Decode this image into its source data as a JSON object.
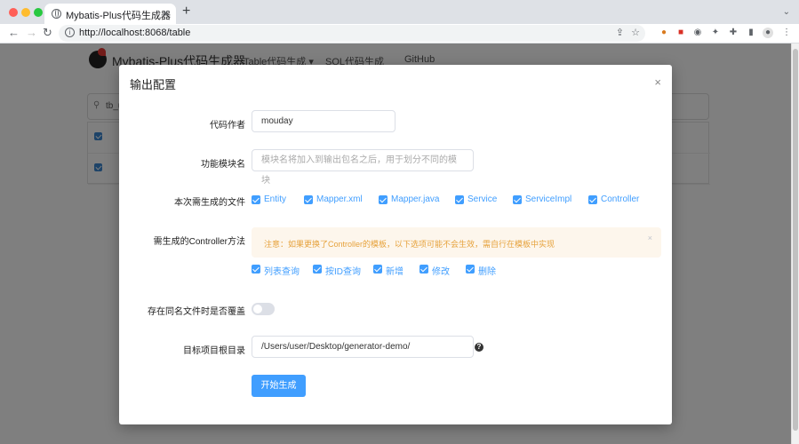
{
  "browser": {
    "tab_title": "Mybatis-Plus代码生成器",
    "tab_close": "×",
    "new_tab": "+",
    "url": "http://localhost:8068/table"
  },
  "page": {
    "brand": "Mybatis-Plus代码生成器",
    "nav": [
      "Table代码生成 ▾",
      "SQL代码生成",
      "GitHub"
    ],
    "search_text": "tb_u"
  },
  "modal": {
    "title": "输出配置",
    "close": "×",
    "author_label": "代码作者",
    "author_value": "mouday",
    "module_label": "功能模块名",
    "module_placeholder": "模块名将加入到输出包名之后，用于划分不同的模块",
    "files_label": "本次需生成的文件",
    "files": [
      "Entity",
      "Mapper.xml",
      "Mapper.java",
      "Service",
      "ServiceImpl",
      "Controller"
    ],
    "controller_label": "需生成的Controller方法",
    "alert_text": "注意：如果更换了Controller的模板，以下选项可能不会生效，需自行在模板中实现",
    "alert_close": "×",
    "methods": [
      "列表查询",
      "按ID查询",
      "新增",
      "修改",
      "删除"
    ],
    "overwrite_label": "存在同名文件时是否覆盖",
    "overwrite_on": false,
    "root_label": "目标项目根目录",
    "root_value": "/Users/user/Desktop/generator-demo/",
    "help": "?",
    "submit": "开始生成"
  },
  "colors": {
    "primary": "#409eff",
    "alert_bg": "#fdf6ec",
    "alert_text": "#e6a23c"
  }
}
